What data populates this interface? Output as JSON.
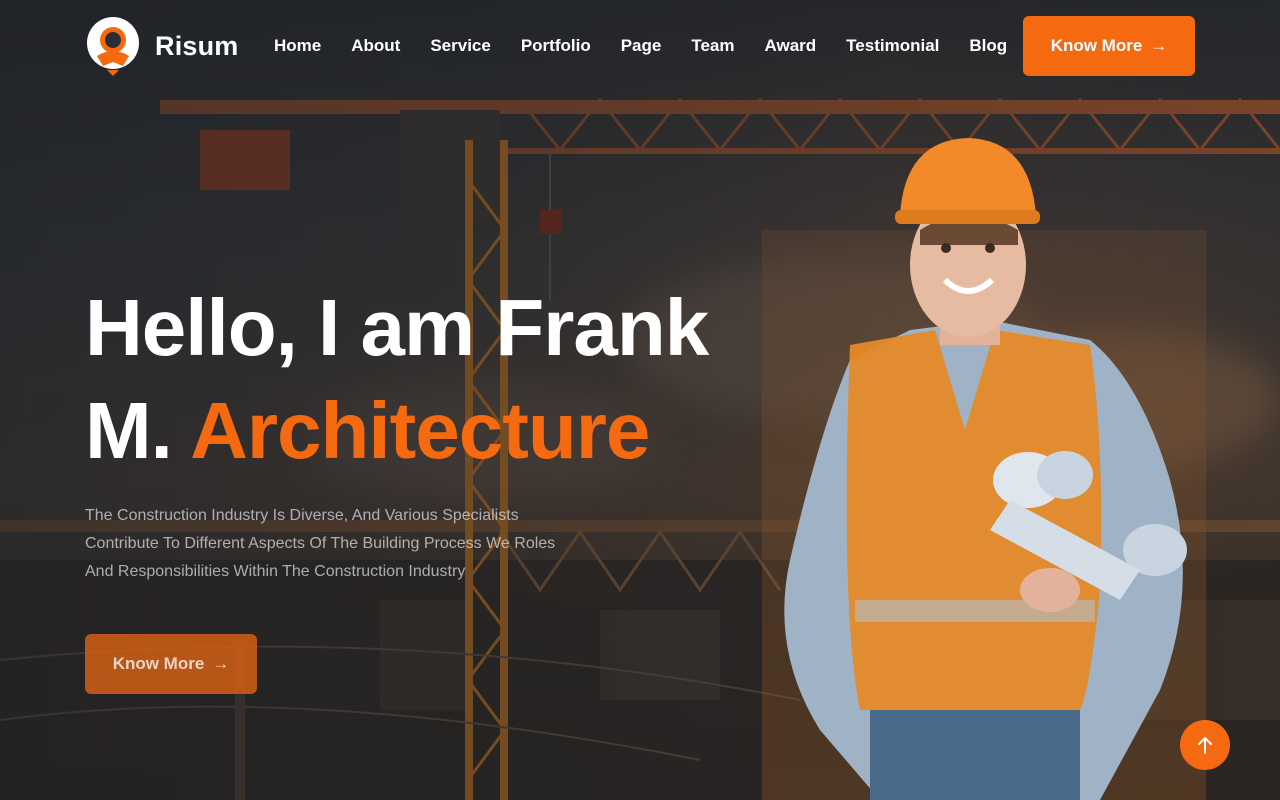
{
  "brand": {
    "name": "Risum",
    "accent": "#f56a10"
  },
  "nav": {
    "items": [
      {
        "label": "Home"
      },
      {
        "label": "About"
      },
      {
        "label": "Service"
      },
      {
        "label": "Portfolio"
      },
      {
        "label": "Page"
      },
      {
        "label": "Team"
      },
      {
        "label": "Award"
      },
      {
        "label": "Testimonial"
      },
      {
        "label": "Blog"
      }
    ],
    "cta_label": "Know More",
    "cta_icon": "arrow-right-icon"
  },
  "hero": {
    "headline_line1": "Hello, I am Frank",
    "headline_line2_plain": "M.",
    "headline_line2_accent": "Architecture",
    "description": [
      "The Construction Industry Is Diverse, And Various Specialists",
      "Contribute To Different Aspects Of The Building Process We Roles",
      "And Responsibilities Within The Construction Industry"
    ],
    "cta_label": "Know More",
    "cta_icon": "arrow-right-icon",
    "background": "construction-crane-sunset-photo",
    "person": "construction-worker-hardhat-vest-blueprints-photo"
  },
  "scroll_top": {
    "icon": "arrow-up-icon"
  }
}
